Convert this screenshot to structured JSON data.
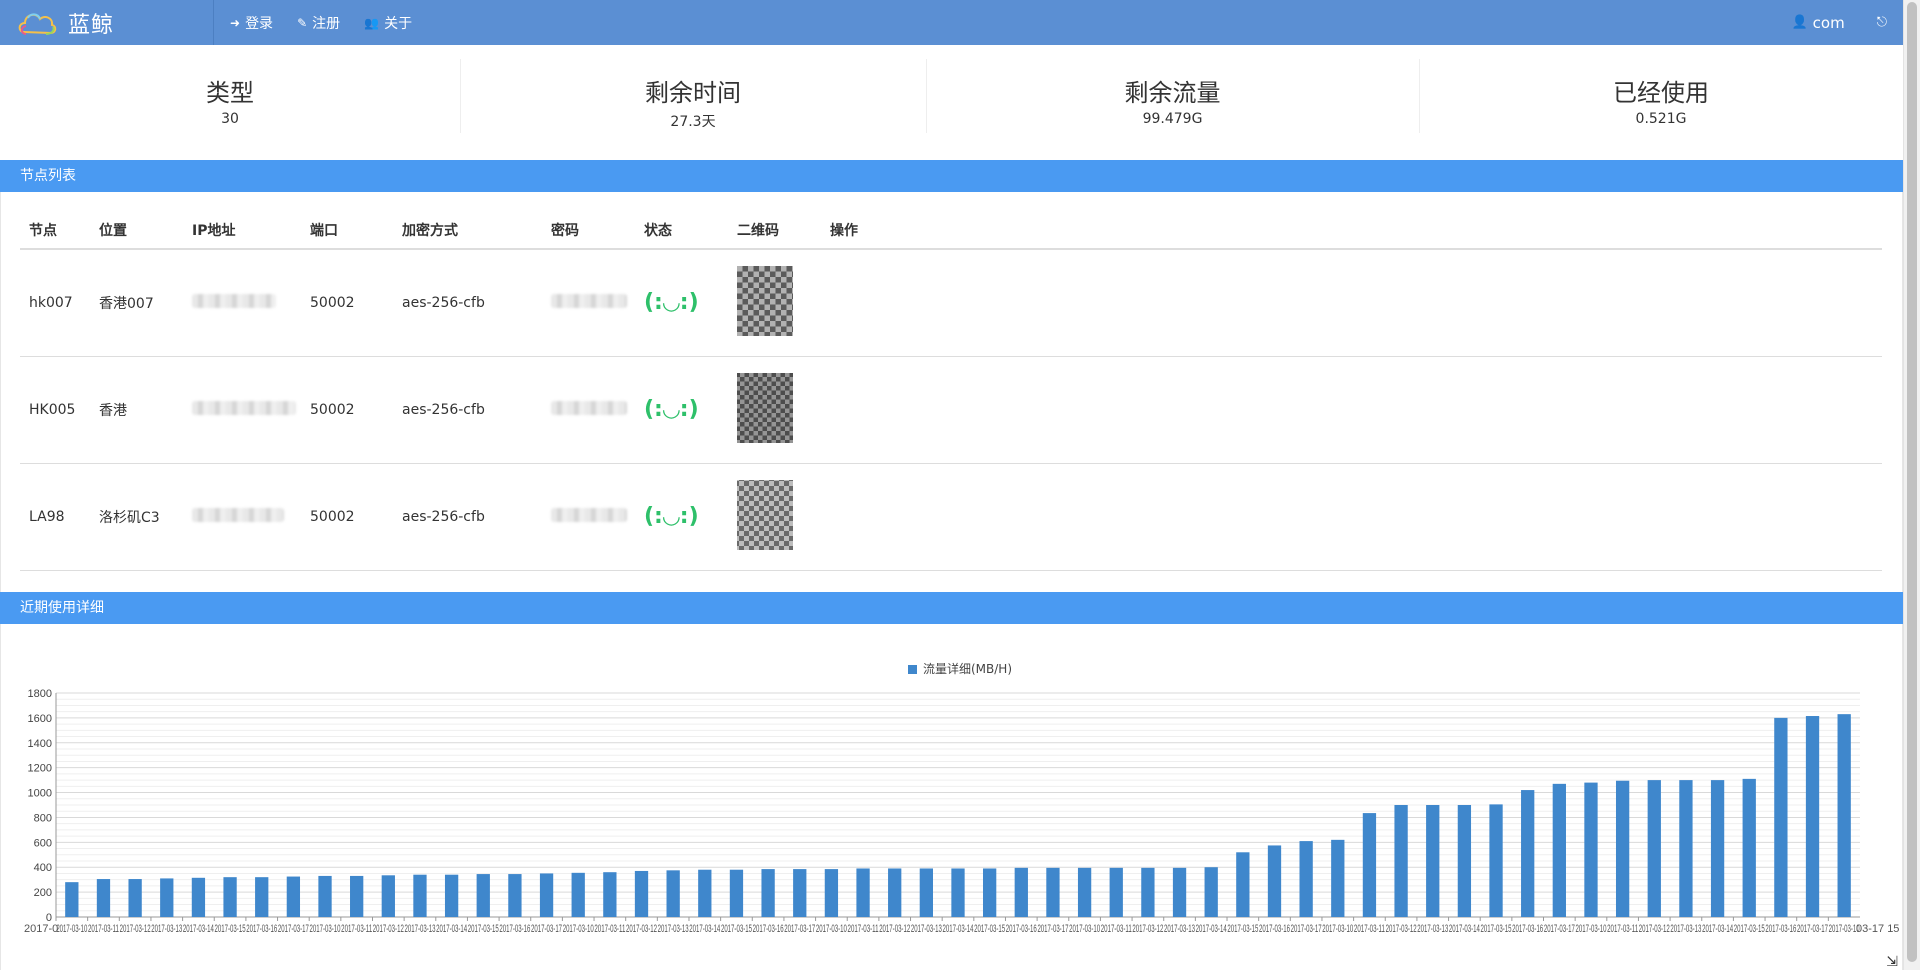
{
  "nav": {
    "brand": "蓝鲸",
    "links": [
      {
        "icon": "sign-in-icon",
        "glyph": "➜",
        "label": "登录"
      },
      {
        "icon": "edit-icon",
        "glyph": "✎",
        "label": "注册"
      },
      {
        "icon": "users-icon",
        "glyph": "👥",
        "label": "关于"
      }
    ],
    "user": {
      "glyph": "👤",
      "label": "com"
    },
    "logout_glyph": "⎋"
  },
  "stats": [
    {
      "title": "类型",
      "value": "30"
    },
    {
      "title": "剩余时间",
      "value": "27.3天"
    },
    {
      "title": "剩余流量",
      "value": "99.479G"
    },
    {
      "title": "已经使用",
      "value": "0.521G"
    }
  ],
  "nodes_panel": {
    "title": "节点列表",
    "headers": [
      "节点",
      "位置",
      "IP地址",
      "端口",
      "加密方式",
      "密码",
      "状态",
      "二维码",
      "操作"
    ],
    "rows": [
      {
        "node": "hk007",
        "location": "香港007",
        "port": "50002",
        "method": "aes-256-cfb",
        "status": "(:◡:)"
      },
      {
        "node": "HK005",
        "location": "香港",
        "port": "50002",
        "method": "aes-256-cfb",
        "status": "(:◡:)"
      },
      {
        "node": "LA98",
        "location": "洛杉矶C3",
        "port": "50002",
        "method": "aes-256-cfb",
        "status": "(:◡:)"
      }
    ]
  },
  "usage_panel": {
    "title": "近期使用详细"
  },
  "colors": {
    "nav": "#5b8fd3",
    "panel": "#4a9af2",
    "bar": "#3f87cc",
    "status": "#2ec06a"
  },
  "chart_data": {
    "type": "bar",
    "legend": "流量详细(MB/H)",
    "ylim": [
      0,
      1800
    ],
    "yticks": [
      0,
      200,
      400,
      600,
      800,
      1000,
      1200,
      1400,
      1600,
      1800
    ],
    "first_label": "2017-0",
    "last_label": "03-17 15:",
    "values": [
      280,
      305,
      305,
      310,
      315,
      320,
      320,
      325,
      330,
      330,
      335,
      340,
      340,
      345,
      345,
      350,
      355,
      360,
      370,
      375,
      380,
      380,
      385,
      385,
      385,
      390,
      390,
      390,
      390,
      390,
      395,
      395,
      395,
      395,
      395,
      395,
      400,
      520,
      575,
      610,
      620,
      835,
      900,
      900,
      900,
      905,
      1020,
      1070,
      1080,
      1095,
      1100,
      1100,
      1100,
      1110,
      1600,
      1615,
      1630
    ]
  }
}
